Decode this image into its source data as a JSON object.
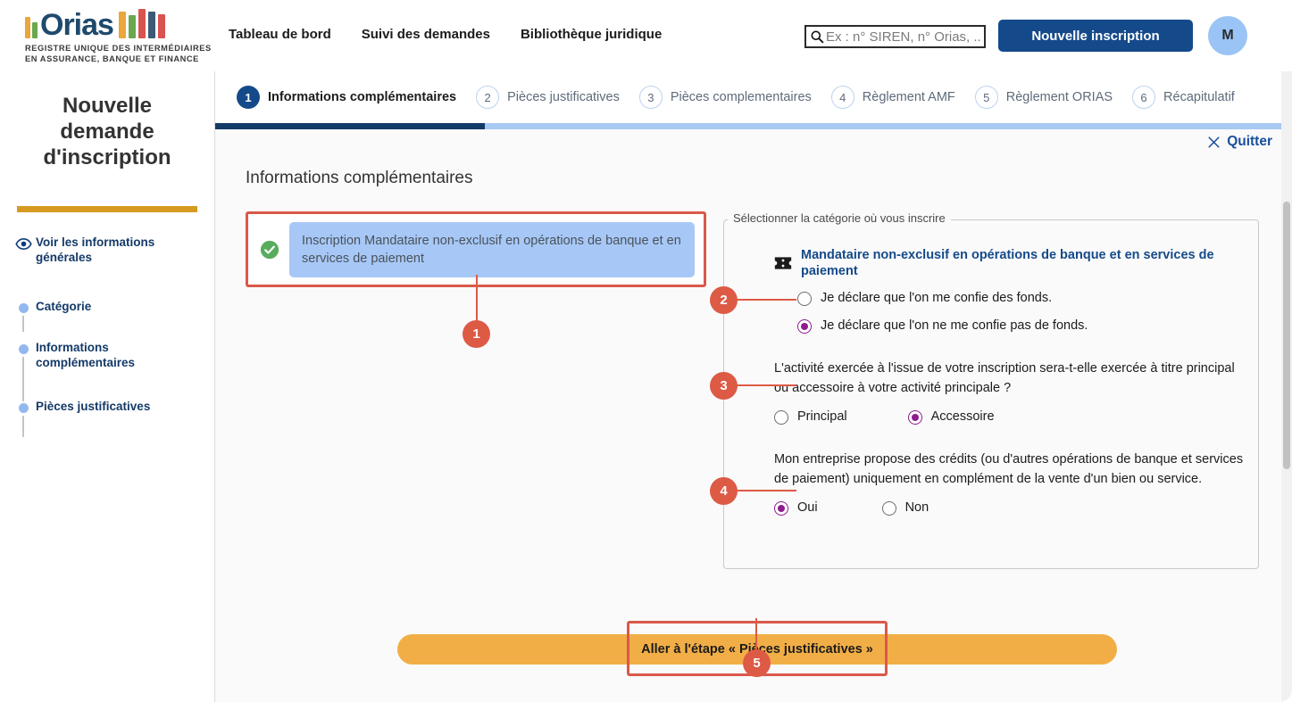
{
  "header": {
    "logo": {
      "word": "Orias",
      "tagline_line1": "REGISTRE UNIQUE DES INTERMÉDIAIRES",
      "tagline_line2": "EN ASSURANCE, BANQUE ET FINANCE",
      "bars_left": [
        "#e9a73c",
        "#6aa84f"
      ],
      "bars_right": [
        "#e9a73c",
        "#6aa84f",
        "#d9534f",
        "#3c5a78",
        "#d9534f"
      ]
    },
    "nav": [
      {
        "label": "Tableau de bord"
      },
      {
        "label": "Suivi des demandes"
      },
      {
        "label": "Bibliothèque juridique"
      }
    ],
    "search": {
      "placeholder": "Ex : n° SIREN, n° Orias, ..",
      "value": ""
    },
    "new_registration_button": "Nouvelle inscription",
    "avatar_initial": "M",
    "accent_color": "#154a8a"
  },
  "sidebar": {
    "title": "Nouvelle demande d'inscription",
    "rule_color": "#d69a21",
    "items": [
      {
        "label": "Voir les informations générales",
        "icon": "eye-icon"
      },
      {
        "label": "Catégorie",
        "icon": "dot-icon"
      },
      {
        "label": "Informations complémentaires",
        "icon": "dot-icon"
      },
      {
        "label": "Pièces justificatives",
        "icon": "dot-icon"
      }
    ]
  },
  "stepper": {
    "steps": [
      {
        "number": "1",
        "label": "Informations complémentaires",
        "active": true
      },
      {
        "number": "2",
        "label": "Pièces justificatives",
        "active": false
      },
      {
        "number": "3",
        "label": "Pièces complementaires",
        "active": false
      },
      {
        "number": "4",
        "label": "Règlement AMF",
        "active": false
      },
      {
        "number": "5",
        "label": "Règlement ORIAS",
        "active": false
      },
      {
        "number": "6",
        "label": "Récapitulatif",
        "active": false
      }
    ],
    "progress_percent": 25,
    "progress_fill_color": "#143a68",
    "progress_track_color": "#a8c9f2"
  },
  "main": {
    "quit_label": "Quitter",
    "page_heading": "Informations complémentaires",
    "selection": {
      "text": "Inscription Mandataire non-exclusif en opérations de banque et en services de paiement",
      "chip_color": "#a7c8f7",
      "status": "validated"
    },
    "fieldset": {
      "legend": "Sélectionner la catégorie où vous inscrire",
      "category_title": "Mandataire non-exclusif en opérations de banque et en services de paiement",
      "funds_options": [
        {
          "label": "Je déclare que l'on me confie des fonds.",
          "checked": false
        },
        {
          "label": "Je déclare que l'on ne me confie pas de fonds.",
          "checked": true
        }
      ],
      "activity_question": "L'activité exercée à l'issue de votre inscription sera-t-elle exercée à titre principal ou accessoire à votre activité principale ?",
      "activity_options": [
        {
          "label": "Principal",
          "checked": false
        },
        {
          "label": "Accessoire",
          "checked": true
        }
      ],
      "credit_question": "Mon entreprise propose des crédits (ou d'autres opérations de banque et services de paiement) uniquement en complément de la vente d'un bien ou service.",
      "credit_options": [
        {
          "label": "Oui",
          "checked": true
        },
        {
          "label": "Non",
          "checked": false
        }
      ],
      "radio_checked_color": "#8d1d8d"
    },
    "cta_label": "Aller à l'étape « Pièces justificatives »",
    "cta_color": "#f2ae46"
  },
  "annotations": {
    "badge_color": "#dd5a45",
    "markers": [
      {
        "number": "1"
      },
      {
        "number": "2"
      },
      {
        "number": "3"
      },
      {
        "number": "4"
      },
      {
        "number": "5"
      }
    ]
  }
}
